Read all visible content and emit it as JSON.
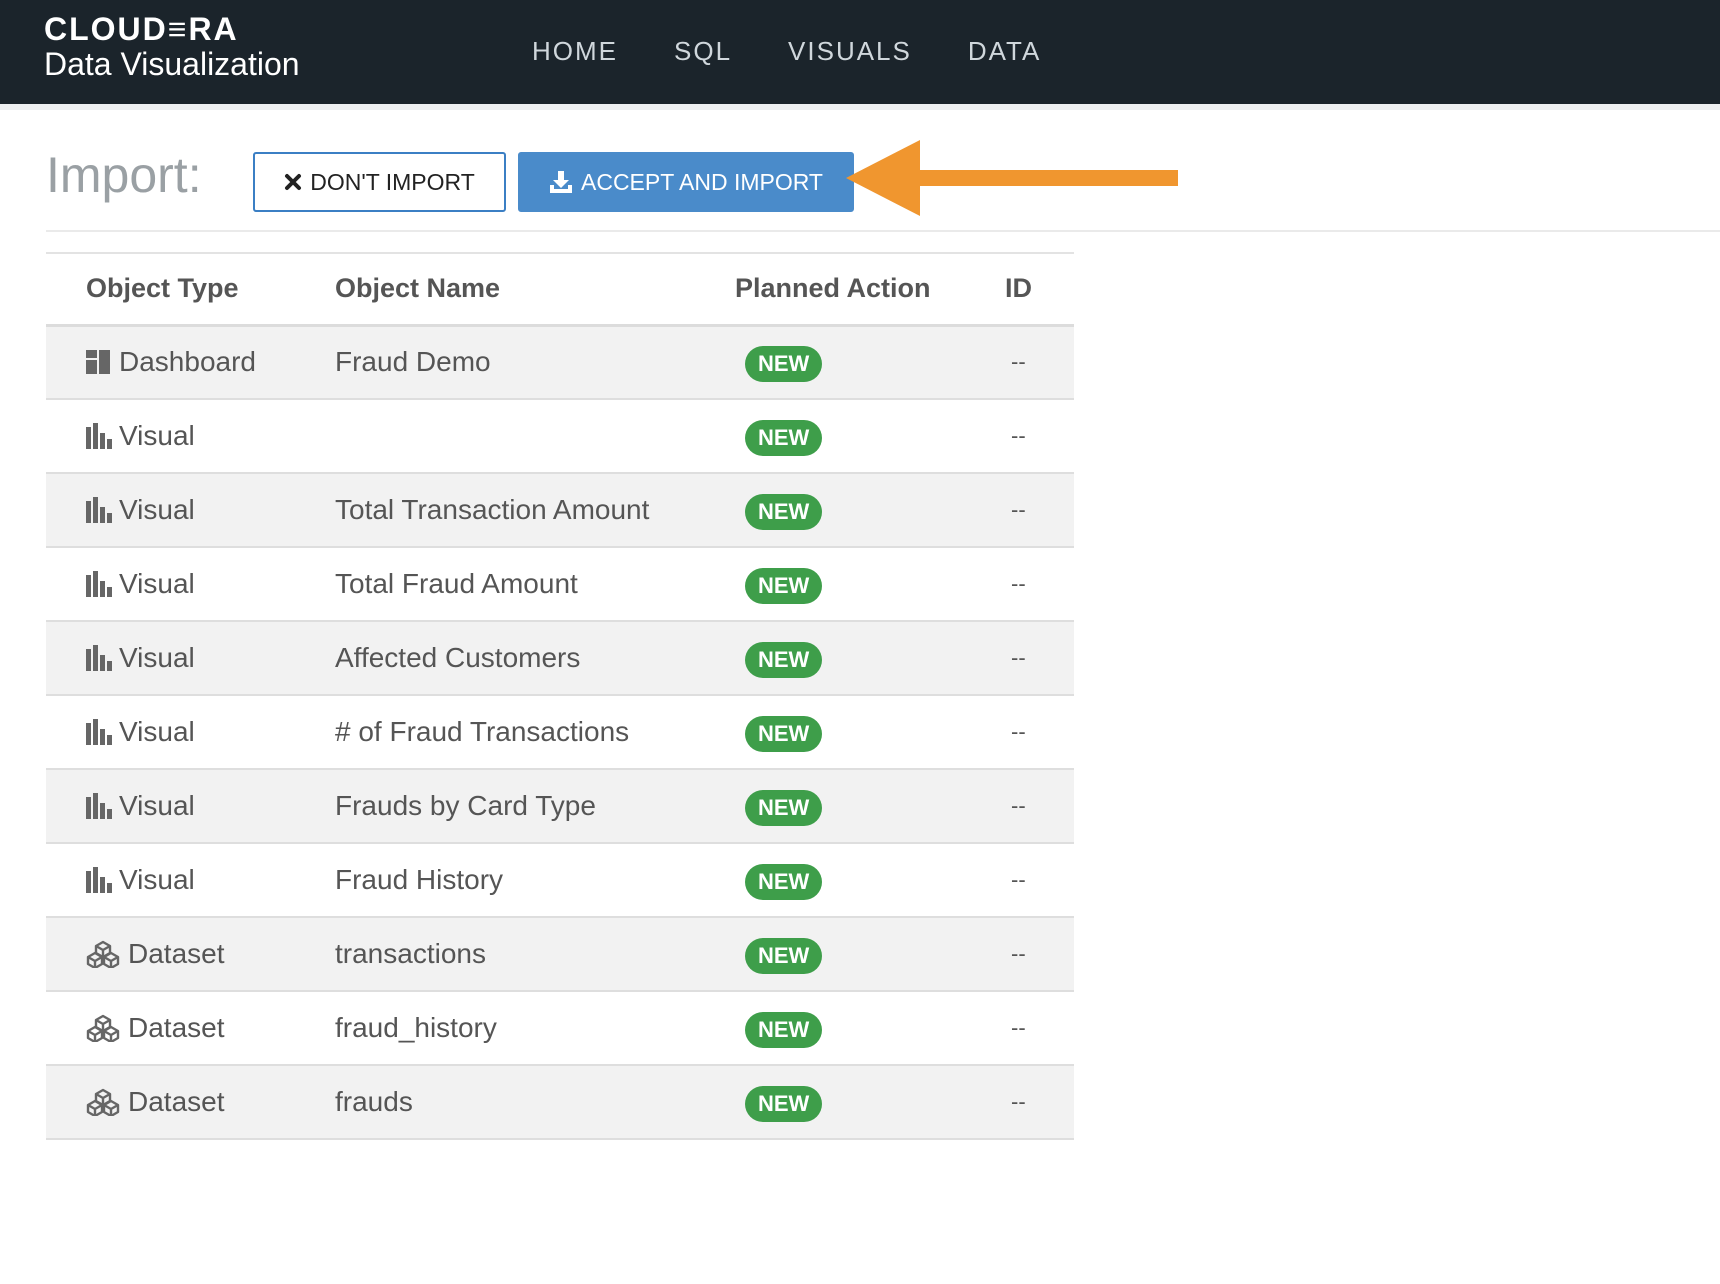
{
  "navbar": {
    "brand_logo": "CLOUD≡RA",
    "brand_sub": "Data Visualization",
    "links": [
      "HOME",
      "SQL",
      "VISUALS",
      "DATA"
    ]
  },
  "import": {
    "title": "Import:",
    "dont_import_label": "DON'T IMPORT",
    "accept_label": "ACCEPT AND IMPORT"
  },
  "colors": {
    "navbar_bg": "#1b242b",
    "accent_blue": "#4a8bca",
    "new_badge": "#3e9e4a",
    "arrow": "#f0962f"
  },
  "table": {
    "headers": {
      "type": "Object Type",
      "name": "Object Name",
      "action": "Planned Action",
      "id": "ID"
    },
    "rows": [
      {
        "type": "Dashboard",
        "icon": "dashboard-icon",
        "name": "Fraud Demo",
        "action": "NEW",
        "id": "--"
      },
      {
        "type": "Visual",
        "icon": "bar-chart-icon",
        "name": "",
        "action": "NEW",
        "id": "--"
      },
      {
        "type": "Visual",
        "icon": "bar-chart-icon",
        "name": "Total Transaction Amount",
        "action": "NEW",
        "id": "--"
      },
      {
        "type": "Visual",
        "icon": "bar-chart-icon",
        "name": "Total Fraud Amount",
        "action": "NEW",
        "id": "--"
      },
      {
        "type": "Visual",
        "icon": "bar-chart-icon",
        "name": "Affected Customers",
        "action": "NEW",
        "id": "--"
      },
      {
        "type": "Visual",
        "icon": "bar-chart-icon",
        "name": "# of Fraud Transactions",
        "action": "NEW",
        "id": "--"
      },
      {
        "type": "Visual",
        "icon": "bar-chart-icon",
        "name": "Frauds by Card Type",
        "action": "NEW",
        "id": "--"
      },
      {
        "type": "Visual",
        "icon": "bar-chart-icon",
        "name": "Fraud History",
        "action": "NEW",
        "id": "--"
      },
      {
        "type": "Dataset",
        "icon": "dataset-cubes-icon",
        "name": "transactions",
        "action": "NEW",
        "id": "--"
      },
      {
        "type": "Dataset",
        "icon": "dataset-cubes-icon",
        "name": "fraud_history",
        "action": "NEW",
        "id": "--"
      },
      {
        "type": "Dataset",
        "icon": "dataset-cubes-icon",
        "name": "frauds",
        "action": "NEW",
        "id": "--"
      }
    ]
  }
}
